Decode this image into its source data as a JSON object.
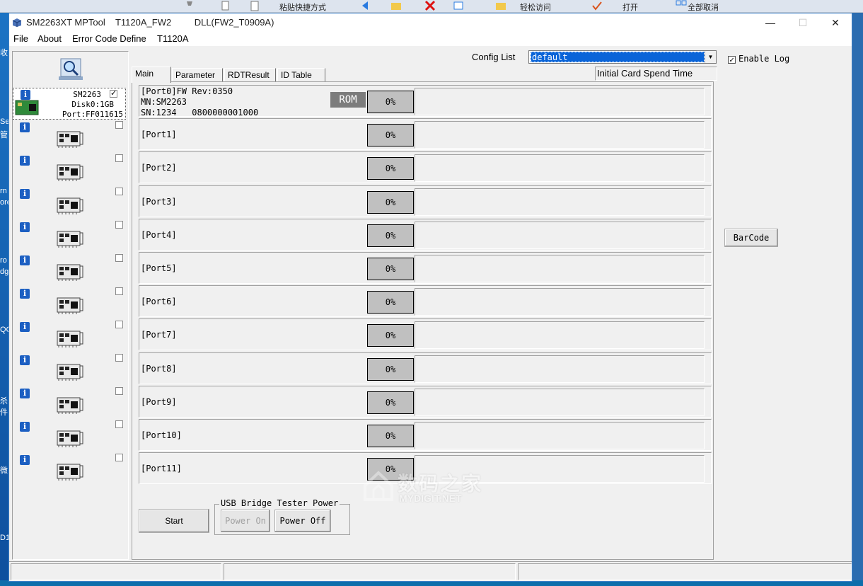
{
  "desktop": {
    "top_labels": [
      "粘贴快捷方式",
      "轻松访问",
      "打开",
      "全部取消"
    ],
    "left_labels": [
      "收",
      "Se",
      "管",
      "rn",
      "ore",
      "ro",
      "dg",
      "QC",
      "杀",
      "件",
      "微",
      "D1"
    ]
  },
  "window": {
    "title": "SM2263XT MPTool    T1120A_FW2         DLL(FW2_T0909A)",
    "controls": {
      "minimize": "—",
      "maximize": "☐",
      "close": "✕"
    }
  },
  "menu": [
    "File",
    "About",
    "Error Code Define",
    "T1120A"
  ],
  "slots": {
    "slot0": {
      "line1": "SM2263",
      "line2": "Disk0:1GB",
      "line3": "Port:FF011615",
      "checked": "✓"
    },
    "count": 12
  },
  "tabs": [
    "Main",
    "Parameter",
    "RDTResult",
    "ID Table"
  ],
  "config": {
    "label": "Config List",
    "value": "default",
    "dropdown_arrow": "▼"
  },
  "enable_log": {
    "label": "Enable Log",
    "checked": "✓"
  },
  "initial_card": "Initial Card Spend Time",
  "ports": [
    {
      "label": "[Port0]FW Rev:0350",
      "mn": "MN:SM2263",
      "sn": "SN:1234   0800000001000",
      "rom": "ROM",
      "percent": "0%"
    },
    {
      "label": "[Port1]",
      "percent": "0%"
    },
    {
      "label": "[Port2]",
      "percent": "0%"
    },
    {
      "label": "[Port3]",
      "percent": "0%"
    },
    {
      "label": "[Port4]",
      "percent": "0%"
    },
    {
      "label": "[Port5]",
      "percent": "0%"
    },
    {
      "label": "[Port6]",
      "percent": "0%"
    },
    {
      "label": "[Port7]",
      "percent": "0%"
    },
    {
      "label": "[Port8]",
      "percent": "0%"
    },
    {
      "label": "[Port9]",
      "percent": "0%"
    },
    {
      "label": "[Port10]",
      "percent": "0%"
    },
    {
      "label": "[Port11]",
      "percent": "0%"
    }
  ],
  "buttons": {
    "start": "Start",
    "group_label": "USB Bridge Tester Power",
    "power_on": "Power On",
    "power_off": "Power Off",
    "barcode": "BarCode"
  },
  "watermark": {
    "cn": "数码之家",
    "en": "MYDIGIT.NET"
  },
  "colors": {
    "selection": "#0a64d8",
    "progress_box": "#c0c0c0",
    "rom_badge": "#7c7c7c",
    "info_icon": "#1c5fc2"
  }
}
